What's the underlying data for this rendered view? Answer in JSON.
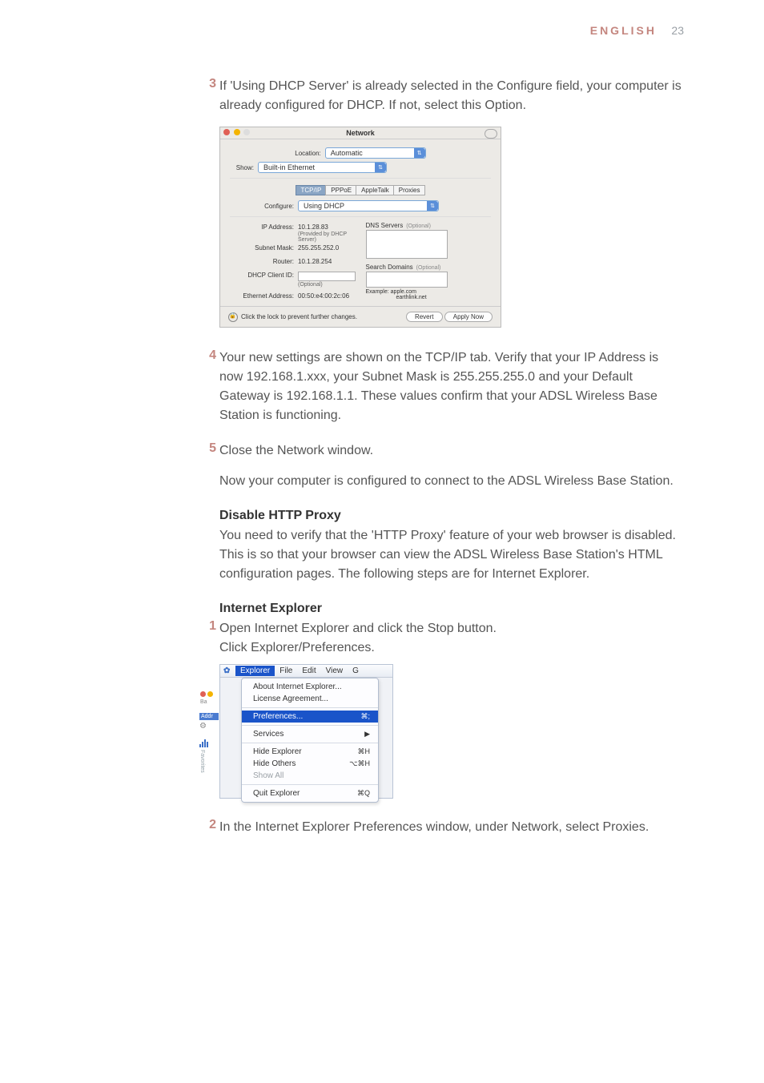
{
  "header": {
    "language": "ENGLISH",
    "page_number": "23"
  },
  "steps": {
    "s3": {
      "num": "3",
      "text": "If 'Using DHCP Server' is already selected in the Configure field, your computer is already configured for DHCP. If not, select this Option."
    },
    "s4": {
      "num": "4",
      "text": "Your new settings are shown on the TCP/IP tab. Verify that your IP Address is now 192.168.1.xxx, your Subnet Mask is 255.255.255.0 and your Default Gateway is 192.168.1.1. These values confirm that your ADSL Wireless Base Station is functioning."
    },
    "s5": {
      "num": "5",
      "text": "Close the Network window."
    },
    "s5_after": "Now your computer is configured to connect to the ADSL Wireless Base Station.",
    "proxy_title": "Disable HTTP Proxy",
    "proxy_body": "You need to verify that the 'HTTP Proxy' feature of your web browser is disabled. This is so that your browser can view the ADSL Wireless Base Station's HTML configuration pages. The following steps are for Internet Explorer.",
    "ie_title": "Internet Explorer",
    "ie1": {
      "num": "1",
      "line1": "Open Internet Explorer and click the Stop button.",
      "line2": "Click Explorer/Preferences."
    },
    "ie2": {
      "num": "2",
      "text": "In the Internet Explorer Preferences window, under Network, select Proxies."
    }
  },
  "mac": {
    "title": "Network",
    "location_label": "Location:",
    "location_value": "Automatic",
    "show_label": "Show:",
    "show_value": "Built-in Ethernet",
    "tabs": {
      "tcpip": "TCP/IP",
      "pppoe": "PPPoE",
      "appletalk": "AppleTalk",
      "proxies": "Proxies"
    },
    "configure_label": "Configure:",
    "configure_value": "Using DHCP",
    "dns_label": "DNS Servers",
    "optional": "(Optional)",
    "ip_label": "IP Address:",
    "ip_value": "10.1.28.83",
    "ip_note": "(Provided by DHCP Server)",
    "subnet_label": "Subnet Mask:",
    "subnet_value": "255.255.252.0",
    "router_label": "Router:",
    "router_value": "10.1.28.254",
    "domains_label": "Search Domains",
    "dhcp_label": "DHCP Client ID:",
    "dhcp_note": "(Optional)",
    "eth_label": "Ethernet Address:",
    "eth_value": "00:50:e4:00:2c:06",
    "example_label": "Example:",
    "example_val1": "apple.com",
    "example_val2": "earthlink.net",
    "lock_text": "Click the lock to prevent further changes.",
    "revert": "Revert",
    "apply": "Apply Now"
  },
  "exp": {
    "menubar": {
      "explorer": "Explorer",
      "file": "File",
      "edit": "Edit",
      "view": "View",
      "g": "G"
    },
    "about": "About Internet Explorer...",
    "license": "License Agreement...",
    "prefs": "Preferences...",
    "prefs_key": "⌘;",
    "services": "Services",
    "services_arrow": "▶",
    "hide_exp": "Hide Explorer",
    "hide_exp_key": "⌘H",
    "hide_oth": "Hide Others",
    "hide_oth_key": "⌥⌘H",
    "show_all": "Show All",
    "quit": "Quit Explorer",
    "quit_key": "⌘Q",
    "addr": "Addr",
    "favorites": "Favorites"
  }
}
